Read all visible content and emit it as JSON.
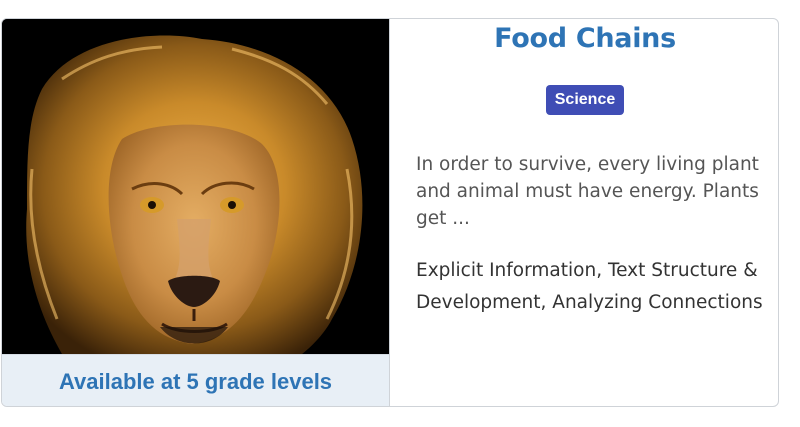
{
  "card": {
    "title": "Food Chains",
    "subject_badge": "Science",
    "description": "In order to survive, every living plant and animal must have energy. Plants get ...",
    "skills": "Explicit Information, Text Structure & Development, Analyzing Connections",
    "grade_levels": "Available at 5 grade levels",
    "image_subject": "lion-photo",
    "colors": {
      "title": "#2e74b5",
      "badge_bg": "#3f4db5",
      "grade_bar_bg": "#e8eff6",
      "grade_text": "#2e74b5"
    }
  }
}
